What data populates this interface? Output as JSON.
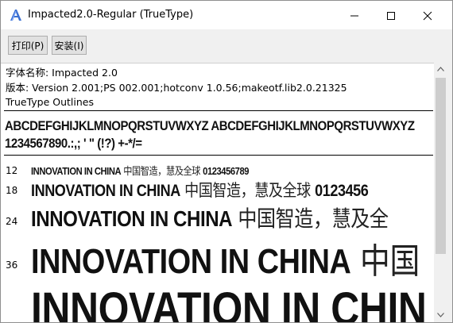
{
  "window": {
    "title": "Impacted2.0-Regular (TrueType)",
    "icon": "font-a-icon",
    "controls": [
      "minimize-icon",
      "maximize-icon",
      "close-icon"
    ]
  },
  "toolbar": {
    "print_label": "打印(P)",
    "install_label": "安装(I)"
  },
  "info": {
    "name_line": "字体名称: Impacted 2.0",
    "version_line": "版本: Version 2.001;PS 002.001;hotconv 1.0.56;makeotf.lib2.0.21325",
    "type_line": "TrueType Outlines"
  },
  "charset": {
    "letters": "ABCDEFGHIJKLMNOPQRSTUVWXYZ ABCDEFGHIJKLMNOPQRSTUVWXYZ",
    "digits": "1234567890.:,; ' \" (!?) +-*/="
  },
  "samples": {
    "latin": "INNOVATION IN CHINA",
    "cjk_full": "中国智造，慧及全球",
    "number": "0123456789",
    "rows": [
      {
        "size": "12",
        "latin": "INNOVATION IN CHINA",
        "cjk": " 中国智造，慧及全球 ",
        "num": "0123456789"
      },
      {
        "size": "18",
        "latin": "INNOVATION IN CHINA",
        "cjk": " 中国智造，慧及全球 ",
        "num": "0123456"
      },
      {
        "size": "24",
        "latin": "INNOVATION IN CHINA",
        "cjk": " 中国智造，慧及全",
        "num": ""
      },
      {
        "size": "36",
        "latin": "INNOVATION IN CHINA",
        "cjk": " 中国",
        "num": ""
      },
      {
        "size": "",
        "latin": "INNOVATION IN CHIN",
        "cjk": "",
        "num": ""
      }
    ]
  },
  "colors": {
    "title_bg": "#ffffff",
    "toolbar_bg": "#f0f0f0",
    "button_bg": "#e1e1e1",
    "button_border": "#adadad",
    "scroll_thumb": "#cdcdcd"
  }
}
